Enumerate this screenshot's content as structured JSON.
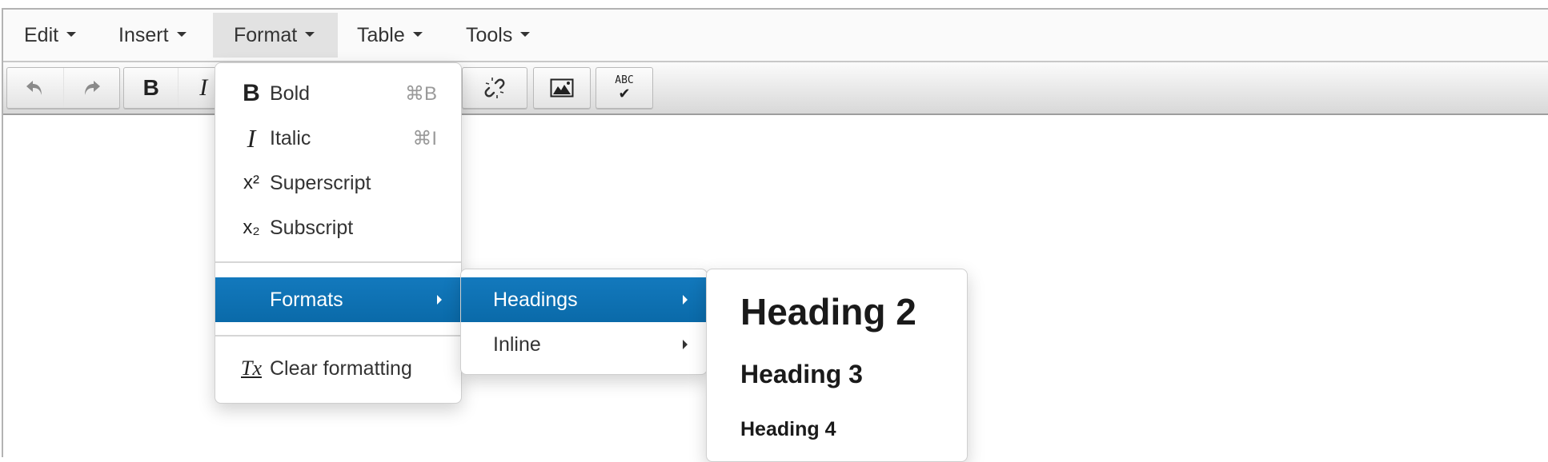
{
  "menubar": {
    "items": [
      {
        "label": "Edit"
      },
      {
        "label": "Insert"
      },
      {
        "label": "Format",
        "active": true
      },
      {
        "label": "Table"
      },
      {
        "label": "Tools"
      }
    ]
  },
  "toolbar": {
    "icons": {
      "undo": "↶",
      "redo": "↷",
      "bold": "B",
      "italic": "I",
      "unlink": "unlink-icon",
      "image": "image-icon",
      "spellcheck_text": "ABC",
      "spellcheck_check": "✔"
    }
  },
  "format_menu": {
    "items": [
      {
        "icon": "B",
        "label": "Bold",
        "shortcut": "⌘B"
      },
      {
        "icon": "I",
        "label": "Italic",
        "shortcut": "⌘I"
      },
      {
        "icon": "x²",
        "label": "Superscript"
      },
      {
        "icon": "x₂",
        "label": "Subscript"
      }
    ],
    "formats_label": "Formats",
    "clear_icon": "Tx",
    "clear_label": "Clear formatting"
  },
  "formats_submenu": {
    "items": [
      {
        "label": "Headings",
        "selected": true
      },
      {
        "label": "Inline"
      }
    ]
  },
  "headings_submenu": {
    "items": [
      {
        "label": "Heading 2"
      },
      {
        "label": "Heading 3"
      },
      {
        "label": "Heading 4"
      }
    ]
  },
  "colors": {
    "highlight": "#0e72b5",
    "menubar_active": "#e2e2e2"
  }
}
